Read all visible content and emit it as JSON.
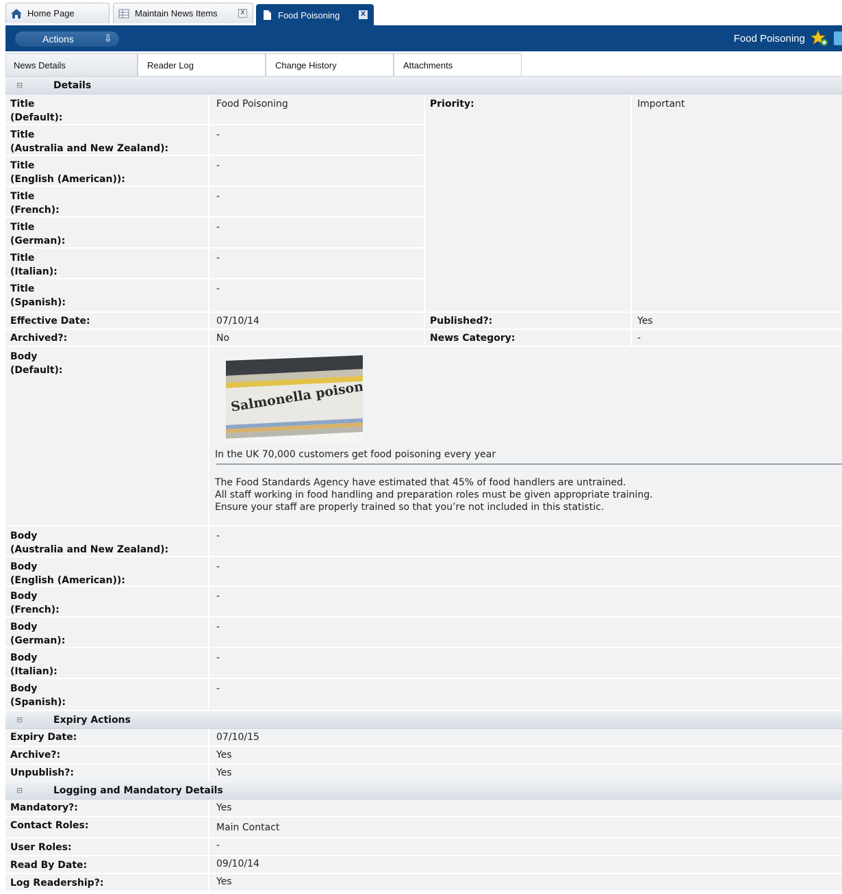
{
  "tabs": [
    {
      "label": "Home Page",
      "icon": "house-icon"
    },
    {
      "label": "Maintain News Items",
      "icon": "table-icon",
      "close": "X"
    },
    {
      "label": "Food Poisoning",
      "icon": "document-icon",
      "close": "X",
      "active": true
    }
  ],
  "actionbar": {
    "actions_label": "Actions",
    "actions_arrow": "⇩",
    "page_title": "Food Poisoning",
    "colors": {
      "bar": "#0d4684",
      "star": "#f2c318"
    }
  },
  "subtabs": [
    "News Details",
    "Reader Log",
    "Change History",
    "Attachments"
  ],
  "sections": {
    "details": {
      "title": "Details",
      "collapse": "⊟",
      "titles": [
        {
          "label1": "Title",
          "label2": "(Default):",
          "value": "Food Poisoning"
        },
        {
          "label1": "Title",
          "label2": "(Australia and New Zealand):",
          "value": "-"
        },
        {
          "label1": "Title",
          "label2": "(English (American)):",
          "value": "-"
        },
        {
          "label1": "Title",
          "label2": "(French):",
          "value": "-"
        },
        {
          "label1": "Title",
          "label2": "(German):",
          "value": "-"
        },
        {
          "label1": "Title",
          "label2": "(Italian):",
          "value": "-"
        },
        {
          "label1": "Title",
          "label2": "(Spanish):",
          "value": "-"
        }
      ],
      "priority_label": "Priority:",
      "priority_value": "Important",
      "effective_date_label": "Effective Date:",
      "effective_date_value": "07/10/14",
      "published_label": "Published?:",
      "published_value": "Yes",
      "archived_label": "Archived?:",
      "archived_value": "No",
      "news_category_label": "News Category:",
      "news_category_value": "-",
      "body_default": {
        "label1": "Body",
        "label2": "(Default):",
        "image_caption": "Salmonella poisoning",
        "headline": "In the UK 70,000 customers get food poisoning every year",
        "paragraph": [
          "The Food Standards Agency have estimated that 45% of food handlers are untrained.",
          "All staff working in food handling and preparation roles must be given appropriate training.",
          "Ensure your staff are properly trained so that you’re not included in this statistic."
        ]
      },
      "bodies": [
        {
          "label1": "Body",
          "label2": "(Australia and New Zealand):",
          "value": "-"
        },
        {
          "label1": "Body",
          "label2": "(English (American)):",
          "value": "-"
        },
        {
          "label1": "Body",
          "label2": "(French):",
          "value": "-"
        },
        {
          "label1": "Body",
          "label2": "(German):",
          "value": "-"
        },
        {
          "label1": "Body",
          "label2": "(Italian):",
          "value": "-"
        },
        {
          "label1": "Body",
          "label2": "(Spanish):",
          "value": "-"
        }
      ]
    },
    "expiry": {
      "title": "Expiry Actions",
      "collapse": "⊟",
      "rows": [
        {
          "label": "Expiry Date:",
          "value": "07/10/15"
        },
        {
          "label": "Archive?:",
          "value": "Yes"
        },
        {
          "label": "Unpublish?:",
          "value": "Yes"
        }
      ]
    },
    "logging": {
      "title": "Logging and Mandatory Details",
      "collapse": "⊟",
      "rows": [
        {
          "label": "Mandatory?:",
          "value": "Yes"
        },
        {
          "label": "Contact Roles:",
          "value": "Main Contact"
        },
        {
          "label": "User Roles:",
          "value": "-"
        },
        {
          "label": "Read By Date:",
          "value": "09/10/14"
        },
        {
          "label": "Log Readership?:",
          "value": "Yes"
        }
      ]
    }
  }
}
